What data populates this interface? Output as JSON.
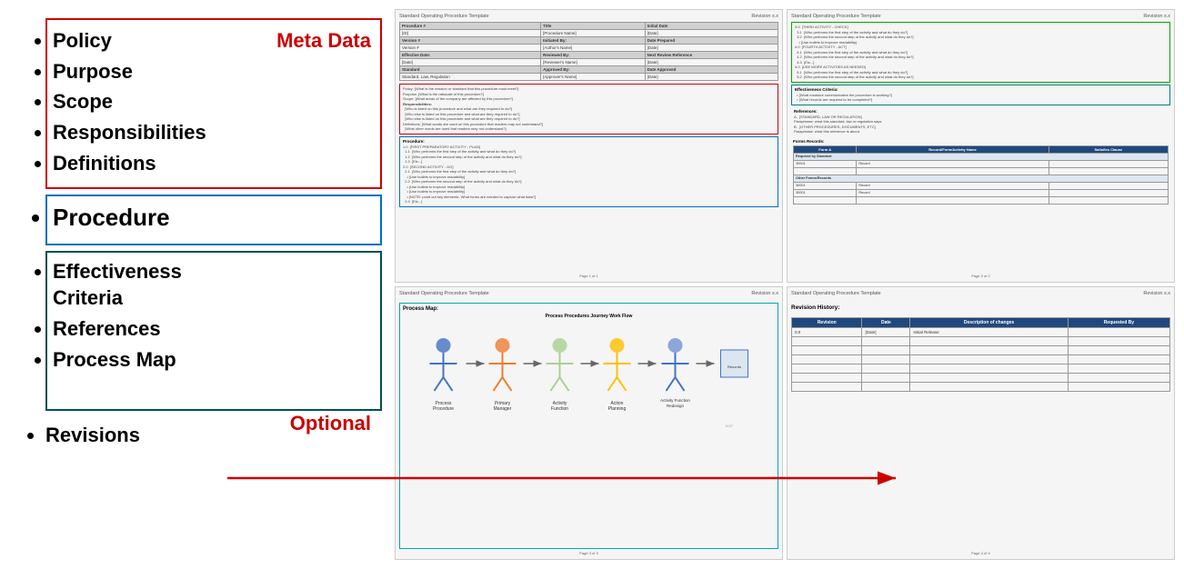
{
  "left": {
    "meta_label": "Meta Data",
    "optional_label": "Optional",
    "meta_items": [
      "Policy",
      "Purpose",
      "Scope",
      "Responsibilities",
      "Definitions"
    ],
    "procedure_item": "Procedure",
    "optional_items": [
      "Effectiveness Criteria",
      "References",
      "Process Map"
    ],
    "revisions_item": "Revisions"
  },
  "cards": {
    "topleft": {
      "header_left": "Standard Operating Procedure Template",
      "header_right": "Revision x.x",
      "table_rows": [
        [
          "Procedure #",
          "Title",
          "Initial Date"
        ],
        [
          "[ID]",
          "[Procedure Name]",
          "[Date]"
        ],
        [
          "Version #",
          "Initiated By:",
          "Date Prepared"
        ],
        [
          "Version #",
          "[Author's Name]",
          "[Date]"
        ],
        [
          "Effective Date:",
          "Reviewed By:",
          "Next Review Reference"
        ],
        [
          "[Date]",
          "[Reviewer's Name]",
          "[Date]"
        ],
        [
          "Standard",
          "Approved By:",
          "Date Approved"
        ],
        [
          "Standard, Law, Regulation",
          "[Approver's Name]",
          "[Date]"
        ]
      ],
      "red_section": {
        "label": "",
        "lines": [
          "Policy:      [What is the mission or standard that this procedure must meet?]",
          "Purpose:  [What is the rationale of this procedure?]",
          "Scope:      [What areas of the company are affected by this procedure?]",
          "Responsibilities:",
          "  [Who is listed on this procedure and what are they required to do?]",
          "  [Who else is listed on this procedure and what are they required to do?]",
          "  [Who else is listed on this procedure and what are they required to do?]",
          "Definitions:  [What words are used on this procedure that readers may not understand?]",
          "  [What other words are used that readers may not understand?]"
        ]
      },
      "blue_section": {
        "label": "Procedure:",
        "lines": [
          "1.0  [FIRST PREPARATORY ACTIVITY - PLAN]",
          "  1.1  [Who performs the first step of the activity and what do they do?]",
          "  1.2  [Who performs the second step of the activity and what do they do?]",
          "  1.3  [Etc...]",
          "2.0  [SECOND ACTIVITY - DO]",
          "  2.1  [Who performs the first step of the activity and what do they do?]",
          "    • [Use bullets to improve readability]",
          "  2.2  [Who performs the second step of the activity and what do they do?]",
          "    • [Use bullets to improve readability]",
          "    • [Use bullets to improve readability]",
          "    • [NOTE: point out key elements. What forms are needed to capture what data?]",
          "  2.3  [Etc...]"
        ]
      },
      "footer": "Page 1 of 1"
    },
    "topright": {
      "header_left": "Standard Operating Procedure Template",
      "header_right": "Revision x.x",
      "green_section": {
        "lines": [
          "3.0  [THIRD ACTIVITY - CHECK]",
          "  3.1  [Who performs the first step of the activity and what do they do?]",
          "  3.2  [Who performs the second step of the activity and what do they do?]",
          "    • [Use bullets to improve readability]",
          "4.0  [FOURTH ACTIVITY - ACT]",
          "  4.1  [Who performs the first step of the activity and what do they do?]",
          "  4.2  [Who performs the second step of the activity and what do they do?]",
          "  4.3  [Etc...]",
          "5.0  [USE MORE ACTIVITIES AS NEEDED]",
          "  5.1  [Who performs the first step of the activity and what do they do?]",
          "  5.2  [Who performs the second step of the activity and what do they do?]"
        ]
      },
      "teal_section": {
        "label": "Effectiveness Criteria:",
        "lines": [
          "  • [What measure communicates the procedure is working?]",
          "  • [What records are required to be completed?]"
        ]
      },
      "references_section": {
        "label": "References:",
        "lines": [
          "A.  [STANDARD, LAW OR REGULATION]",
          "Paraphrase: what this standard, law or regulation says.",
          "B.  [OTHER PROCEDURES, DOCUMENTS, ETC]",
          "Paraphrase: what this reference is about."
        ]
      },
      "forms_label": "Forms Records:",
      "forms_table": {
        "headers": [
          "Form A",
          "Record/Form/Activity Name",
          "Satisfies Clause"
        ],
        "group1_header": "Required by Standard",
        "group1_rows": [
          [
            "30001",
            "Record",
            ""
          ],
          [
            "",
            "",
            ""
          ]
        ],
        "group2_header": "Other Forms/Records",
        "group2_rows": [
          [
            "30001",
            "Record",
            ""
          ],
          [
            "30001",
            "Record",
            ""
          ],
          [
            "",
            "",
            ""
          ]
        ]
      },
      "footer": "Page 2 of 2"
    },
    "bottomleft": {
      "header_left": "Standard Operating Procedure Template",
      "header_right": "Revision x.x",
      "process_map_title": "Process Map:",
      "flow_title": "Process Procedures Journey Work Flow",
      "flow_steps": [
        "Process Procedure",
        "Primary Manager",
        "Activity Function",
        "Action Planning",
        "Activity Function Redesign"
      ],
      "footer": "Page 3 of 3"
    },
    "bottomright": {
      "header_left": "Standard Operating Procedure Template",
      "header_right": "Revision x.x",
      "revision_label": "Revision History:",
      "table_headers": [
        "Revision",
        "Date",
        "Description of changes",
        "Requested By"
      ],
      "table_rows": [
        [
          "0.0",
          "[Date]",
          "Initial Release",
          ""
        ],
        [
          "",
          "",
          "",
          ""
        ],
        [
          "",
          "",
          "",
          ""
        ],
        [
          "",
          "",
          "",
          ""
        ],
        [
          "",
          "",
          "",
          ""
        ]
      ],
      "footer": "Page 4 of 4"
    }
  }
}
